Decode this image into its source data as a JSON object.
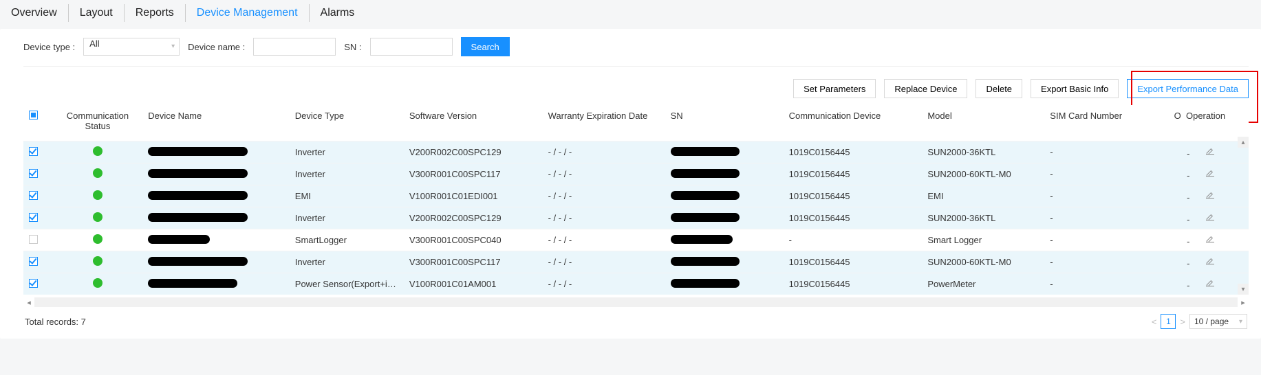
{
  "tabs": {
    "overview": "Overview",
    "layout": "Layout",
    "reports": "Reports",
    "device_mgmt": "Device Management",
    "alarms": "Alarms"
  },
  "filters": {
    "device_type_label": "Device type :",
    "device_type_value": "All",
    "device_name_label": "Device name :",
    "device_name_value": "",
    "sn_label": "SN :",
    "sn_value": "",
    "search": "Search"
  },
  "actions": {
    "set_params": "Set Parameters",
    "replace": "Replace Device",
    "delete": "Delete",
    "export_basic": "Export Basic Info",
    "export_perf": "Export Performance Data"
  },
  "columns": {
    "comm_status": "Communication Status",
    "device_name": "Device Name",
    "device_type": "Device Type",
    "software_version": "Software Version",
    "warranty": "Warranty Expiration Date",
    "sn": "SN",
    "comm_device": "Communication Device",
    "model": "Model",
    "sim": "SIM Card Number",
    "operation": "Operation",
    "op_clip": "O"
  },
  "rows": [
    {
      "checked": true,
      "type": "Inverter",
      "sw": "V200R002C00SPC129",
      "warranty": "- / - / -",
      "cd": "1019C0156445",
      "model": "SUN2000-36KTL",
      "sim": "-"
    },
    {
      "checked": true,
      "type": "Inverter",
      "sw": "V300R001C00SPC117",
      "warranty": "- / - / -",
      "cd": "1019C0156445",
      "model": "SUN2000-60KTL-M0",
      "sim": "-"
    },
    {
      "checked": true,
      "type": "EMI",
      "sw": "V100R001C01EDI001",
      "warranty": "- / - / -",
      "cd": "1019C0156445",
      "model": "EMI",
      "sim": "-"
    },
    {
      "checked": true,
      "type": "Inverter",
      "sw": "V200R002C00SPC129",
      "warranty": "- / - / -",
      "cd": "1019C0156445",
      "model": "SUN2000-36KTL",
      "sim": "-"
    },
    {
      "checked": false,
      "type": "SmartLogger",
      "sw": "V300R001C00SPC040",
      "warranty": "- / - / -",
      "cd": "-",
      "model": "Smart Logger",
      "sim": "-"
    },
    {
      "checked": true,
      "type": "Inverter",
      "sw": "V300R001C00SPC117",
      "warranty": "- / - / -",
      "cd": "1019C0156445",
      "model": "SUN2000-60KTL-M0",
      "sim": "-"
    },
    {
      "checked": true,
      "type": "Power Sensor(Export+im...",
      "sw": "V100R001C01AM001",
      "warranty": "- / - / -",
      "cd": "1019C0156445",
      "model": "PowerMeter",
      "sim": "-"
    }
  ],
  "footer": {
    "total": "Total records: 7",
    "page": "1",
    "per_page": "10 / page"
  }
}
